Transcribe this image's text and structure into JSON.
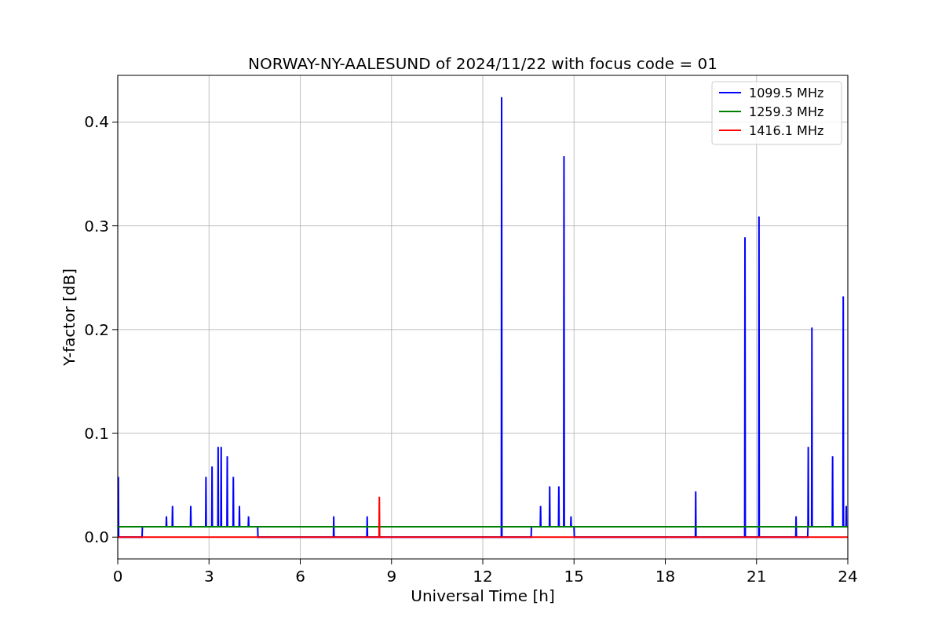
{
  "figure": {
    "chart_data": {
      "type": "line",
      "title": "NORWAY-NY-AALESUND of 2024/11/22 with focus code = 01",
      "xlabel": "Universal Time [h]",
      "ylabel": "Y-factor [dB]",
      "x": [
        0,
        0.02,
        0.03,
        0.8,
        0.81,
        1.59,
        1.6,
        1.61,
        1.79,
        1.8,
        1.81,
        2.39,
        2.4,
        2.41,
        2.89,
        2.9,
        2.91,
        3.09,
        3.1,
        3.11,
        3.29,
        3.3,
        3.31,
        3.39,
        3.4,
        3.41,
        3.59,
        3.6,
        3.61,
        3.79,
        3.8,
        3.81,
        3.99,
        4.0,
        4.01,
        4.29,
        4.3,
        4.31,
        4.6,
        4.61,
        7.09,
        7.1,
        7.11,
        8.19,
        8.2,
        8.21,
        8.59,
        8.6,
        8.61,
        12.61,
        12.62,
        12.63,
        13.59,
        13.6,
        13.89,
        13.9,
        13.91,
        14.19,
        14.2,
        14.21,
        14.49,
        14.5,
        14.51,
        14.66,
        14.67,
        14.68,
        14.89,
        14.9,
        14.91,
        15.0,
        15.01,
        18.99,
        19.0,
        19.01,
        20.61,
        20.62,
        20.63,
        21.07,
        21.08,
        21.09,
        22.29,
        22.3,
        22.31,
        22.68,
        22.69,
        22.7,
        22.71,
        22.81,
        22.82,
        22.83,
        23.49,
        23.5,
        23.51,
        23.84,
        23.85,
        23.86,
        23.94,
        23.95,
        23.96,
        24
      ],
      "series": [
        {
          "name": "1099.5 MHz",
          "color": "#0000ff",
          "values": [
            0,
            0.058,
            0,
            0,
            0.01,
            0.01,
            0.02,
            0.01,
            0.01,
            0.03,
            0.01,
            0.01,
            0.03,
            0.01,
            0.01,
            0.058,
            0.01,
            0.01,
            0.068,
            0.01,
            0.01,
            0.087,
            0.01,
            0.01,
            0.087,
            0.01,
            0.01,
            0.078,
            0.01,
            0.01,
            0.058,
            0.01,
            0.01,
            0.03,
            0.01,
            0.01,
            0.02,
            0.01,
            0.01,
            0,
            0,
            0.02,
            0,
            0,
            0.02,
            0,
            0,
            0,
            0,
            0,
            0.424,
            0,
            0,
            0.01,
            0.01,
            0.03,
            0.01,
            0.01,
            0.049,
            0.01,
            0.01,
            0.049,
            0.01,
            0.01,
            0.367,
            0.01,
            0.01,
            0.02,
            0.01,
            0.01,
            0,
            0,
            0.044,
            0,
            0,
            0.289,
            0,
            0,
            0.309,
            0,
            0,
            0.02,
            0,
            0,
            0.01,
            0.087,
            0.01,
            0.01,
            0.202,
            0.01,
            0.01,
            0.078,
            0.01,
            0.01,
            0.232,
            0.01,
            0.01,
            0.03,
            0.01,
            0.01
          ]
        },
        {
          "name": "1259.3 MHz",
          "color": "#008000",
          "values": [
            0.01,
            0.01,
            0.01,
            0.01,
            0.01,
            0.01,
            0.01,
            0.01,
            0.01,
            0.01,
            0.01,
            0.01,
            0.01,
            0.01,
            0.01,
            0.01,
            0.01,
            0.01,
            0.01,
            0.01,
            0.01,
            0.01,
            0.01,
            0.01,
            0.01,
            0.01,
            0.01,
            0.01,
            0.01,
            0.01,
            0.01,
            0.01,
            0.01,
            0.01,
            0.01,
            0.01,
            0.01,
            0.01,
            0.01,
            0.01,
            0.01,
            0.01,
            0.01,
            0.01,
            0.01,
            0.01,
            0.01,
            0.01,
            0.01,
            0.01,
            0.01,
            0.01,
            0.01,
            0.01,
            0.01,
            0.01,
            0.01,
            0.01,
            0.01,
            0.01,
            0.01,
            0.01,
            0.01,
            0.01,
            0.01,
            0.01,
            0.01,
            0.01,
            0.01,
            0.01,
            0.01,
            0.01,
            0.01,
            0.01,
            0.01,
            0.01,
            0.01,
            0.01,
            0.01,
            0.01,
            0.01,
            0.01,
            0.01,
            0.01,
            0.01,
            0.01,
            0.01,
            0.01,
            0.01,
            0.01,
            0.01,
            0.01,
            0.01,
            0.01,
            0.01,
            0.01,
            0.01,
            0.01,
            0.01,
            0.01
          ]
        },
        {
          "name": "1416.1 MHz",
          "color": "#ff0000",
          "values": [
            0,
            0,
            0,
            0,
            0,
            0,
            0,
            0,
            0,
            0,
            0,
            0,
            0,
            0,
            0,
            0,
            0,
            0,
            0,
            0,
            0,
            0,
            0,
            0,
            0,
            0,
            0,
            0,
            0,
            0,
            0,
            0,
            0,
            0,
            0,
            0,
            0,
            0,
            0,
            0,
            0,
            0,
            0,
            0,
            0,
            0,
            0,
            0.039,
            0,
            0,
            0,
            0,
            0,
            0,
            0,
            0,
            0,
            0,
            0,
            0,
            0,
            0,
            0,
            0,
            0,
            0,
            0,
            0,
            0,
            0,
            0,
            0,
            0,
            0,
            0,
            0,
            0,
            0,
            0,
            0,
            0,
            0,
            0,
            0,
            0,
            0,
            0,
            0,
            0,
            0,
            0,
            0,
            0,
            0,
            0,
            0,
            0,
            0,
            0,
            0
          ]
        }
      ],
      "grid": true,
      "legend": true,
      "xlim": [
        0,
        24
      ],
      "ylim": [
        -0.021,
        0.445
      ],
      "xticks": [
        0,
        3,
        6,
        9,
        12,
        15,
        18,
        21,
        24
      ],
      "yticks": [
        {
          "value": 0,
          "label": "0.0"
        },
        {
          "value": 0.1,
          "label": "0.1"
        },
        {
          "value": 0.2,
          "label": "0.2"
        },
        {
          "value": 0.3,
          "label": "0.3"
        },
        {
          "value": 0.4,
          "label": "0.4"
        }
      ]
    }
  }
}
